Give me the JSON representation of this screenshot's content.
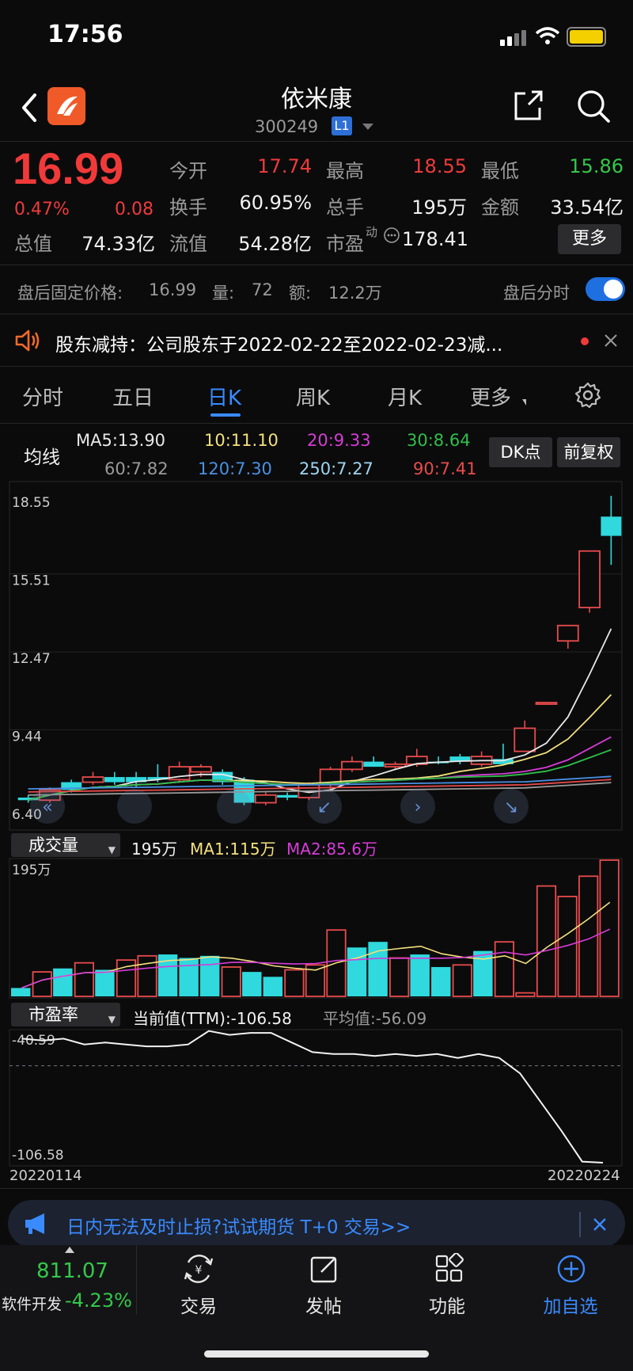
{
  "status": {
    "time": "17:56"
  },
  "header": {
    "name": "依米康",
    "code": "300249",
    "level": "L1"
  },
  "quote": {
    "price": "16.99",
    "change_pct": "0.47%",
    "change": "0.08",
    "rows": [
      [
        {
          "label": "今开",
          "value": "17.74",
          "color": "red"
        },
        {
          "label": "最高",
          "value": "18.55",
          "color": "red"
        },
        {
          "label": "最低",
          "value": "15.86",
          "color": "green"
        }
      ],
      [
        {
          "label": "换手",
          "value": "60.95%",
          "color": "white"
        },
        {
          "label": "总手",
          "value": "195万",
          "color": "white"
        },
        {
          "label": "金额",
          "value": "33.54亿",
          "color": "white"
        }
      ],
      [
        {
          "label": "总值",
          "value": "74.33亿",
          "color": "white"
        },
        {
          "label": "流值",
          "value": "54.28亿",
          "color": "white"
        },
        {
          "label": "市盈",
          "value": "178.41",
          "color": "white",
          "sup": "动"
        }
      ]
    ],
    "more_label": "更多"
  },
  "after_hours": {
    "price_label": "盘后固定价格:",
    "price": "16.99",
    "vol_label": "量:",
    "vol": "72",
    "amt_label": "额:",
    "amt": "12.2万",
    "toggle_label": "盘后分时"
  },
  "news": {
    "text": "股东减持：公司股东于2022-02-22至2022-02-23减..."
  },
  "tabs": [
    {
      "label": "分时",
      "active": false
    },
    {
      "label": "五日",
      "active": false
    },
    {
      "label": "日K",
      "active": true
    },
    {
      "label": "周K",
      "active": false
    },
    {
      "label": "月K",
      "active": false
    },
    {
      "label": "更多",
      "active": false
    }
  ],
  "ma_legend": {
    "title": "均线",
    "items": [
      {
        "text": "MA5:13.90",
        "color": "#e8e8e8"
      },
      {
        "text": "10:11.10",
        "color": "#f3e07c"
      },
      {
        "text": "20:9.33",
        "color": "#d63cd6"
      },
      {
        "text": "30:8.64",
        "color": "#2fbf4a"
      },
      {
        "text": "60:7.82",
        "color": "#9a9a9a"
      },
      {
        "text": "120:7.30",
        "color": "#4a90e2"
      },
      {
        "text": "250:7.27",
        "color": "#9fd4f0"
      },
      {
        "text": "90:7.41",
        "color": "#e84b4b"
      }
    ],
    "dk_button": "DK点",
    "adjust_button": "前复权"
  },
  "kline_axis": {
    "ticks": [
      "18.55",
      "15.51",
      "12.47",
      "9.44",
      "6.40"
    ]
  },
  "volume": {
    "select": "成交量",
    "value": "195万",
    "ma1": "MA1:115万",
    "ma2": "MA2:85.6万",
    "axis_top": "195万"
  },
  "pe": {
    "select": "市盈率",
    "current": "当前值(TTM):-106.58",
    "avg": "平均值:-56.09",
    "axis_top": "-40.59",
    "axis_bottom": "-106.58",
    "date_start": "20220114",
    "date_end": "20220224"
  },
  "ad": {
    "text": "日内无法及时止损?试试期货 T+0 交易>>"
  },
  "bottom_nav": {
    "index_value": "811.07",
    "index_name": "软件开发",
    "index_change": "-4.23%",
    "items": [
      {
        "label": "交易",
        "icon": "trade-icon"
      },
      {
        "label": "发帖",
        "icon": "post-icon"
      },
      {
        "label": "功能",
        "icon": "functions-icon"
      },
      {
        "label": "加自选",
        "icon": "add-watchlist-icon"
      }
    ]
  },
  "chart_data": [
    {
      "type": "candlestick",
      "ylim": [
        6.4,
        18.55
      ],
      "candles": [
        {
          "o": 6.8,
          "h": 6.9,
          "l": 6.6,
          "c": 6.7,
          "up": false
        },
        {
          "o": 6.7,
          "h": 7.2,
          "l": 6.6,
          "c": 7.1,
          "up": true
        },
        {
          "o": 7.1,
          "h": 7.5,
          "l": 7.0,
          "c": 7.4,
          "up": false
        },
        {
          "o": 7.4,
          "h": 7.8,
          "l": 7.3,
          "c": 7.6,
          "up": true
        },
        {
          "o": 7.6,
          "h": 7.8,
          "l": 7.3,
          "c": 7.4,
          "up": false
        },
        {
          "o": 7.4,
          "h": 7.8,
          "l": 7.2,
          "c": 7.6,
          "up": false
        },
        {
          "o": 7.6,
          "h": 8.1,
          "l": 7.4,
          "c": 7.5,
          "up": false
        },
        {
          "o": 7.5,
          "h": 8.2,
          "l": 7.4,
          "c": 8.0,
          "up": true
        },
        {
          "o": 7.8,
          "h": 8.1,
          "l": 7.6,
          "c": 8.0,
          "up": true
        },
        {
          "o": 7.8,
          "h": 7.9,
          "l": 7.3,
          "c": 7.4,
          "up": false
        },
        {
          "o": 7.5,
          "h": 7.6,
          "l": 6.5,
          "c": 6.6,
          "up": false
        },
        {
          "o": 6.6,
          "h": 7.0,
          "l": 6.5,
          "c": 6.9,
          "up": true
        },
        {
          "o": 6.9,
          "h": 7.0,
          "l": 6.7,
          "c": 6.8,
          "up": false
        },
        {
          "o": 6.8,
          "h": 7.4,
          "l": 6.7,
          "c": 7.3,
          "up": true
        },
        {
          "o": 7.3,
          "h": 8.0,
          "l": 7.1,
          "c": 7.9,
          "up": true
        },
        {
          "o": 7.9,
          "h": 8.4,
          "l": 7.8,
          "c": 8.2,
          "up": true
        },
        {
          "o": 8.2,
          "h": 8.4,
          "l": 8.0,
          "c": 8.0,
          "up": false
        },
        {
          "o": 8.0,
          "h": 8.2,
          "l": 7.9,
          "c": 8.1,
          "up": true
        },
        {
          "o": 8.1,
          "h": 8.7,
          "l": 8.0,
          "c": 8.4,
          "up": true
        },
        {
          "o": 8.2,
          "h": 8.4,
          "l": 8.1,
          "c": 8.2,
          "up": false
        },
        {
          "o": 8.2,
          "h": 8.5,
          "l": 8.1,
          "c": 8.4,
          "up": false
        },
        {
          "o": 8.4,
          "h": 8.6,
          "l": 8.0,
          "c": 8.1,
          "up": true
        },
        {
          "o": 8.3,
          "h": 8.9,
          "l": 8.2,
          "c": 8.1,
          "up": false
        },
        {
          "o": 8.6,
          "h": 9.8,
          "l": 8.6,
          "c": 9.5,
          "up": true
        },
        {
          "o": 10.5,
          "h": 10.5,
          "l": 10.5,
          "c": 10.5,
          "up": true
        },
        {
          "o": 12.9,
          "h": 13.4,
          "l": 12.6,
          "c": 13.5,
          "up": true
        },
        {
          "o": 14.2,
          "h": 16.4,
          "l": 14.0,
          "c": 16.4,
          "up": true
        },
        {
          "o": 17.74,
          "h": 18.55,
          "l": 15.86,
          "c": 16.99,
          "up": false
        }
      ]
    },
    {
      "type": "bar",
      "name": "成交量",
      "unit": "万",
      "ylim": [
        0,
        195
      ],
      "values": [
        12,
        35,
        40,
        48,
        38,
        52,
        58,
        60,
        55,
        58,
        42,
        35,
        28,
        38,
        45,
        95,
        70,
        78,
        55,
        60,
        42,
        45,
        65,
        78,
        5,
        158,
        143,
        172,
        195
      ],
      "up": [
        false,
        true,
        false,
        true,
        false,
        true,
        true,
        false,
        false,
        false,
        true,
        false,
        false,
        true,
        true,
        true,
        false,
        false,
        true,
        false,
        false,
        true,
        false,
        true,
        true,
        true,
        true,
        true,
        true
      ]
    },
    {
      "type": "line",
      "name": "市盈率",
      "ylim": [
        -106.58,
        -40.59
      ],
      "values": [
        -42,
        -43,
        -42,
        -45,
        -44,
        -45,
        -46,
        -46,
        -45,
        -38,
        -40,
        -39,
        -39,
        -44,
        -49,
        -50,
        -50,
        -51,
        -50,
        -51,
        -50,
        -52,
        -50,
        -52,
        -60,
        -75,
        -90,
        -106,
        -106.58
      ]
    }
  ]
}
